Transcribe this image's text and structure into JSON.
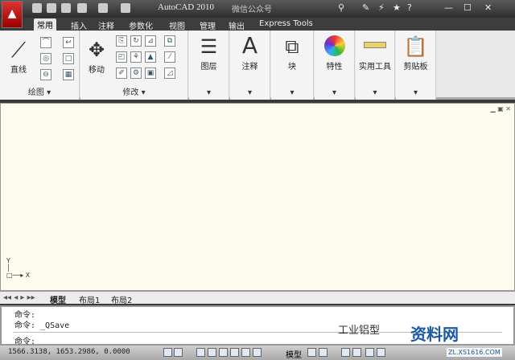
{
  "titlebar": {
    "app_title": "AutoCAD 2010",
    "subtitle": "微信公众号"
  },
  "tabs": [
    {
      "label": "常用",
      "active": true
    },
    {
      "label": "插入"
    },
    {
      "label": "注释"
    },
    {
      "label": "参数化"
    },
    {
      "label": "视图"
    },
    {
      "label": "管理"
    },
    {
      "label": "输出"
    },
    {
      "label": "Express Tools"
    }
  ],
  "ribbon": {
    "draw": {
      "label": "绘图",
      "line": "直线"
    },
    "modify": {
      "label": "修改",
      "move": "移动"
    },
    "panels": [
      {
        "label": "图层",
        "icon": "layers-icon"
      },
      {
        "label": "注释",
        "icon": "annotation-icon"
      },
      {
        "label": "块",
        "icon": "block-icon"
      },
      {
        "label": "特性",
        "icon": "color-wheel-icon"
      },
      {
        "label": "实用工具",
        "icon": "measure-icon"
      },
      {
        "label": "剪贴板",
        "icon": "clipboard-icon"
      }
    ]
  },
  "ucs": {
    "x": "X",
    "y": "Y"
  },
  "layout_tabs": [
    "模型",
    "布局1",
    "布局2"
  ],
  "command": {
    "lines": [
      "命令:",
      "命令: _QSave"
    ],
    "prompt": "命令:"
  },
  "status": {
    "coords": "1566.3138, 1653.2986, 0.0000",
    "model": "模型"
  },
  "watermark": {
    "text1": "工业铝型",
    "text2": "资料网",
    "url": "ZL.XS1616.COM"
  }
}
